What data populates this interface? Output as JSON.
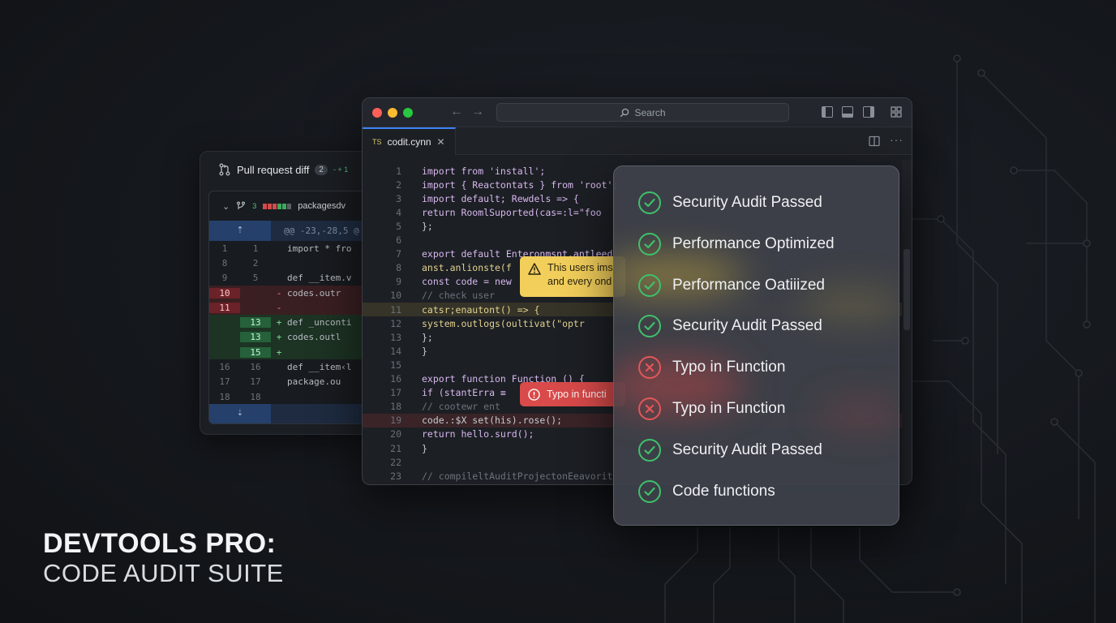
{
  "brand": {
    "line1": "DEVTOOLS PRO:",
    "line2": "CODE AUDIT SUITE"
  },
  "diff": {
    "title": "Pull request diff",
    "count": "2",
    "stat": "- + 1",
    "file": {
      "additions": "3",
      "name": "packagesdv"
    },
    "hunk": "@@ -23,-28,5 @",
    "lines": [
      {
        "l1": "1",
        "l2": "1",
        "type": "ctx",
        "sign": "",
        "code": "import * fro"
      },
      {
        "l1": "8",
        "l2": "2",
        "type": "ctx",
        "sign": "",
        "code": ""
      },
      {
        "l1": "9",
        "l2": "5",
        "type": "ctx",
        "sign": "",
        "code": "def __item.v"
      },
      {
        "l1": "10",
        "l2": "",
        "type": "del",
        "sign": "-",
        "code": "  codes.outr"
      },
      {
        "l1": "11",
        "l2": "",
        "type": "del",
        "sign": "-",
        "code": ""
      },
      {
        "l1": "",
        "l2": "13",
        "type": "add",
        "sign": "+",
        "code": "def _unconti"
      },
      {
        "l1": "",
        "l2": "13",
        "type": "add",
        "sign": "+",
        "code": "  codes.outl"
      },
      {
        "l1": "",
        "l2": "15",
        "type": "add",
        "sign": "+",
        "code": ""
      },
      {
        "l1": "16",
        "l2": "16",
        "type": "ctx",
        "sign": "",
        "code": "def __item‹l"
      },
      {
        "l1": "17",
        "l2": "17",
        "type": "ctx",
        "sign": "",
        "code": "  package.ou"
      },
      {
        "l1": "18",
        "l2": "18",
        "type": "ctx",
        "sign": "",
        "code": ""
      }
    ]
  },
  "editor": {
    "search_placeholder": "Search",
    "tab_lang": "TS",
    "tab_name": "codit.cynn",
    "lines": [
      {
        "n": "1",
        "code": "import from 'install';"
      },
      {
        "n": "2",
        "code": "import { Reactontats } from 'root';"
      },
      {
        "n": "3",
        "code": "import default; Rewdels => {"
      },
      {
        "n": "4",
        "code": "  return RoomlSuported(cas=:l=\"foo"
      },
      {
        "n": "5",
        "code": "};"
      },
      {
        "n": "6",
        "code": ""
      },
      {
        "n": "7",
        "code": "export default Enteronmsnt.antleed"
      },
      {
        "n": "8",
        "code": "  anst.anlionste(f"
      },
      {
        "n": "9",
        "code": "  const code = new"
      },
      {
        "n": "10",
        "code": "    // check user"
      },
      {
        "n": "11",
        "code": "    catsr;enautont() => {"
      },
      {
        "n": "12",
        "code": "      system.outlogs(oultivat(\"optr"
      },
      {
        "n": "13",
        "code": "    };"
      },
      {
        "n": "14",
        "code": "}"
      },
      {
        "n": "15",
        "code": ""
      },
      {
        "n": "16",
        "code": "export function Function () {"
      },
      {
        "n": "17",
        "code": "  if (stantErra ≡"
      },
      {
        "n": "18",
        "code": "    // cootewr ent"
      },
      {
        "n": "19",
        "code": "    code.:$X set(his).rose();"
      },
      {
        "n": "20",
        "code": "    return hello.surd();"
      },
      {
        "n": "21",
        "code": "  }"
      },
      {
        "n": "22",
        "code": ""
      },
      {
        "n": "23",
        "code": "  // compileltAuditProjectonEeavorit"
      }
    ],
    "tip_warning": {
      "line1": "This users ims",
      "line2": "and every ond"
    },
    "tip_error": "Typo in functi"
  },
  "audit": {
    "items": [
      {
        "status": "pass",
        "label": "Security Audit Passed"
      },
      {
        "status": "pass",
        "label": "Performance Optimized"
      },
      {
        "status": "pass",
        "label": "Performance Oatiiized"
      },
      {
        "status": "pass",
        "label": "Security Audit Passed"
      },
      {
        "status": "fail",
        "label": "Typo in Function"
      },
      {
        "status": "fail",
        "label": "Typo in Function"
      },
      {
        "status": "pass",
        "label": "Security Audit Passed"
      },
      {
        "status": "pass",
        "label": "Code functions"
      }
    ]
  },
  "colors": {
    "pass": "#3fc06a",
    "fail": "#e0575a",
    "warning": "#f2cf5b",
    "close": "#ff5f57",
    "minimize": "#febc2e",
    "zoom": "#28c840",
    "accent": "#3b82f6"
  }
}
